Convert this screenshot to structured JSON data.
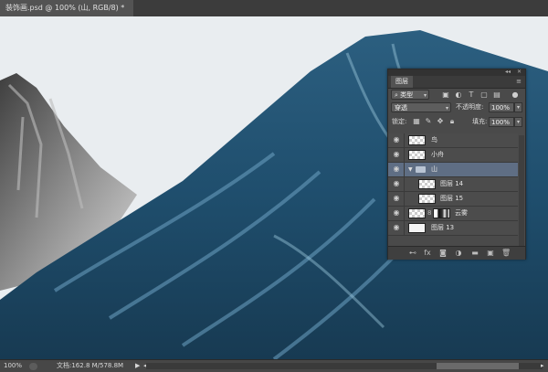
{
  "document_tab": {
    "title": "装饰画.psd @ 100% (山, RGB/8) *"
  },
  "layers_panel": {
    "title": "图层",
    "menu_icon": "panel-menu-icon",
    "filter": {
      "label": "类型",
      "icon": "search-icon"
    },
    "blend_mode": "穿透",
    "opacity_label": "不透明度:",
    "opacity_value": "100%",
    "lock_label": "锁定:",
    "fill_label": "填充:",
    "fill_value": "100%",
    "layers": [
      {
        "name": "鸟",
        "type": "layer",
        "thumb": "transparent"
      },
      {
        "name": "小舟",
        "type": "layer",
        "thumb": "transparent"
      },
      {
        "name": "山",
        "type": "group",
        "selected": true
      },
      {
        "name": "图层 14",
        "type": "layer",
        "thumb": "transparent",
        "indent": true
      },
      {
        "name": "图层 15",
        "type": "layer",
        "thumb": "transparent",
        "indent": true
      },
      {
        "name": "云雾",
        "type": "masked",
        "thumb": "transparent"
      },
      {
        "name": "图层 13",
        "type": "layer",
        "thumb": "white"
      }
    ]
  },
  "status_bar": {
    "zoom": "100%",
    "doc_info": "文档:162.8 M/578.8M"
  }
}
